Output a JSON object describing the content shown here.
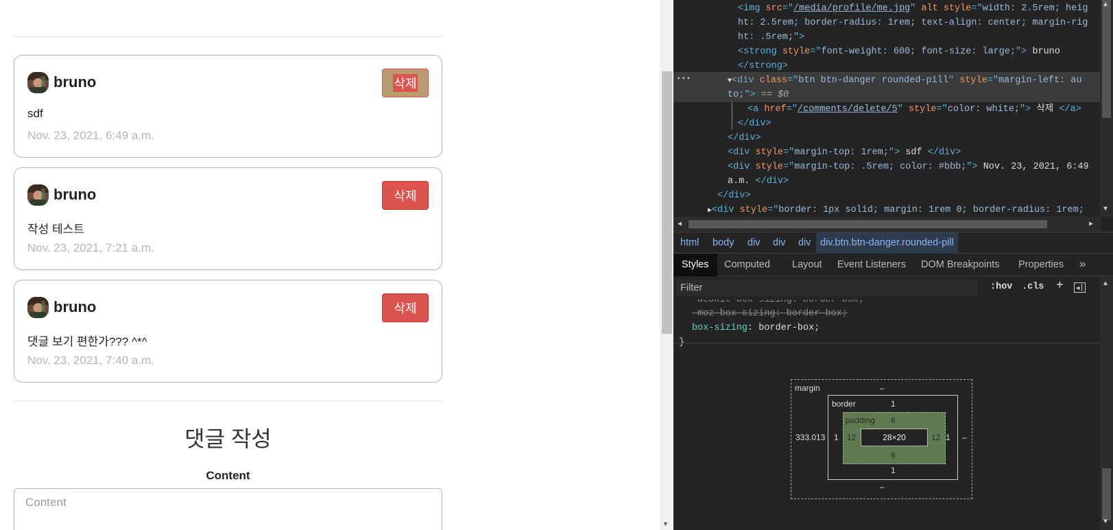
{
  "comments": [
    {
      "author": "bruno",
      "delete_label": "삭제",
      "body": "sdf",
      "date": "Nov. 23, 2021, 6:49 a.m."
    },
    {
      "author": "bruno",
      "delete_label": "삭제",
      "body": "작성 테스트",
      "date": "Nov. 23, 2021, 7:21 a.m."
    },
    {
      "author": "bruno",
      "delete_label": "삭제",
      "body": "댓글 보기 편한가??? ^*^",
      "date": "Nov. 23, 2021, 7:40 a.m."
    }
  ],
  "write_section": {
    "title": "댓글 작성",
    "content_label": "Content",
    "content_placeholder": "Content"
  },
  "devtools": {
    "code": {
      "img_open": "<img ",
      "src_attr": "src",
      "eq_quote": "=\"",
      "src_val": "/media/profile/me.jpg",
      "close_quote": "\"",
      "alt_attr": " alt ",
      "style_attr": "style",
      "img_style_1": "width: 2.5rem; heig",
      "img_style_2": "ht: 2.5rem; border-radius: 1rem; text-align: center; margin-rig",
      "img_style_3": "ht: .5rem;",
      "tag_end": "\">",
      "strong_open": "<strong ",
      "strong_style": "font-weight: 600; font-size: large;",
      "strong_text": " bruno",
      "strong_close": "</strong>",
      "div_open": "<div ",
      "class_attr": "class",
      "btn_class": "btn btn-danger rounded-pill",
      "btn_style_1": "margin-left: au",
      "btn_style_2": "to;",
      "selected_marker": " == $0",
      "a_open": "<a ",
      "href_attr": "href",
      "href_val": "/comments/delete/5",
      "a_style": "color: white;",
      "a_text": " 삭제 ",
      "a_close": "</a>",
      "div_close": "</div>",
      "div_mt_style": "margin-top: 1rem;",
      "sdf_text": " sdf ",
      "div_date_style": "margin-top: .5rem; color: #bbb;",
      "date_text_1": " Nov. 23, 2021, 6:49",
      "date_text_2": "a.m. ",
      "next_div_style": "border: 1px solid; margin: 1rem 0; border-radius: 1rem;"
    },
    "breadcrumbs": [
      "html",
      "body",
      "div",
      "div",
      "div"
    ],
    "breadcrumb_active": "div.btn.btn-danger.rounded-pill",
    "tabs": [
      "Styles",
      "Computed",
      "Layout",
      "Event Listeners",
      "DOM Breakpoints",
      "Properties"
    ],
    "filter_placeholder": "Filter",
    "filter_hov": ":hov",
    "filter_cls": ".cls",
    "styles": {
      "webkit_prop": "-webkit-box-sizing",
      "webkit_val": ": border-box;",
      "moz_rule": "-moz-box-sizing: border-box;",
      "prop": "box-sizing",
      "val": ": border-box;",
      "close_brace": "}"
    },
    "box_model": {
      "margin_label": "margin",
      "margin_top": "–",
      "margin_left": "333.013",
      "margin_right": "–",
      "margin_bottom": "–",
      "border_label": "border",
      "border_top": "1",
      "border_left": "1",
      "border_right": "1",
      "border_bottom": "1",
      "padding_label": "padding",
      "padding_top": "6",
      "padding_left": "12",
      "padding_right": "12",
      "padding_bottom": "6",
      "content": "28×20"
    }
  }
}
